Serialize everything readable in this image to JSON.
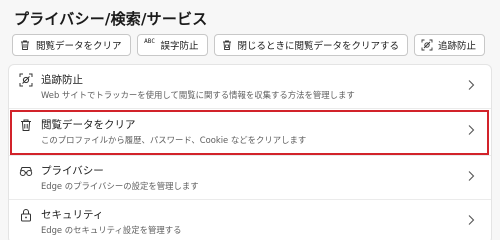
{
  "page": {
    "title": "プライバシー/検索/サービス"
  },
  "chips": [
    {
      "label": "閲覧データをクリア",
      "icon": "trash-icon"
    },
    {
      "label": "誤字防止",
      "icon": "spellcheck-icon",
      "icon_text": "ABC"
    },
    {
      "label": "閉じるときに閲覧データをクリアする",
      "icon": "lock-trash-icon"
    },
    {
      "label": "追跡防止",
      "icon": "tracking-prevention-icon"
    }
  ],
  "settings": [
    {
      "title": "追跡防止",
      "description": "Web サイトでトラッカーを使用して閲覧に関する情報を収集する方法を管理します",
      "icon": "tracking-prevention-icon"
    },
    {
      "title": "閲覧データをクリア",
      "description": "このプロファイルから履歴、パスワード、Cookie などをクリアします",
      "icon": "trash-icon",
      "highlighted": true
    },
    {
      "title": "プライバシー",
      "description": "Edge のプライバシーの設定を管理します",
      "icon": "privacy-glasses-icon"
    },
    {
      "title": "セキュリティ",
      "description": "Edge のセキュリティ設定を管理する",
      "icon": "lock-icon"
    }
  ],
  "colors": {
    "highlight": "#d2232a",
    "text": "#1b1b1b",
    "secondary_text": "#5e5e5e"
  }
}
